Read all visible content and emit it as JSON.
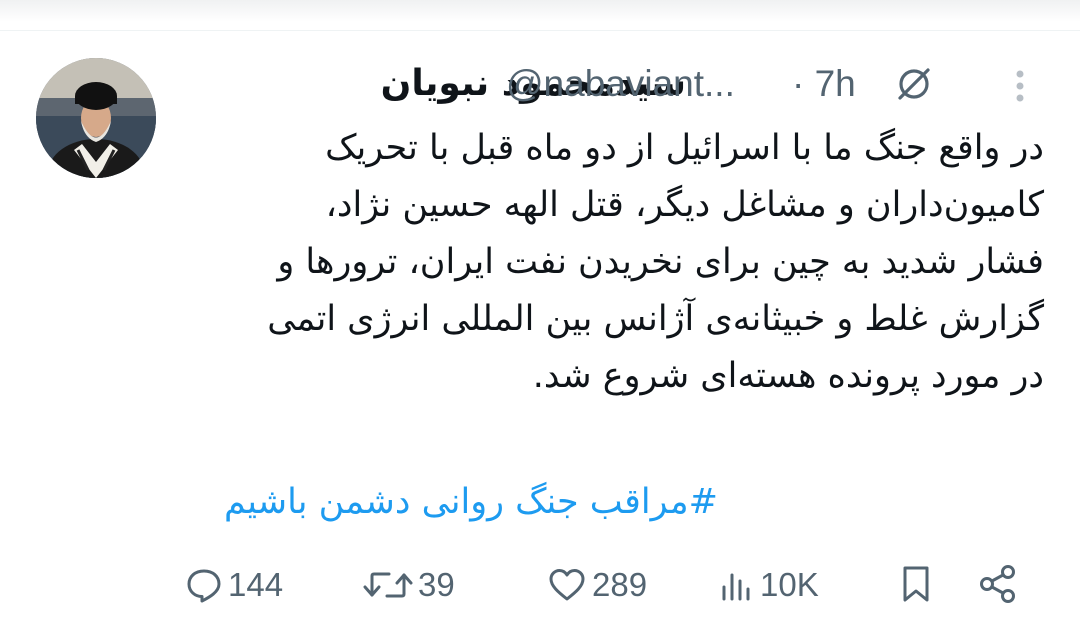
{
  "tweet": {
    "author_name": "سیدمحمود نبویان",
    "handle": "@nabaviant...",
    "time": "· 7h",
    "body": "در واقع جنگ ما با اسرائیل از دو ماه قبل با تحریک\nکامیون‌داران و مشاغل دیگر، قتل الهه حسین نژاد،\nفشار شدید به چین برای نخریدن نفت ایران، ترورها و\nگزارش غلط و خبیثانه‌ی  آژانس بین المللی انرژی اتمی\nدر مورد پرونده هسته‌ای شروع شد.",
    "hashtag": "#مراقب جنگ روانی دشمن باشیم"
  },
  "icons": {
    "grok": "grok-icon",
    "more": "more-vertical-icon",
    "reply": "reply-icon",
    "retweet": "retweet-icon",
    "like": "heart-icon",
    "views": "views-chart-icon",
    "bookmark": "bookmark-icon",
    "share": "share-icon"
  },
  "actions": {
    "replies": "144",
    "retweets": "39",
    "likes": "289",
    "views": "10K"
  },
  "colors": {
    "text": "#0f1419",
    "secondary": "#536471",
    "link": "#1d9bf0"
  }
}
